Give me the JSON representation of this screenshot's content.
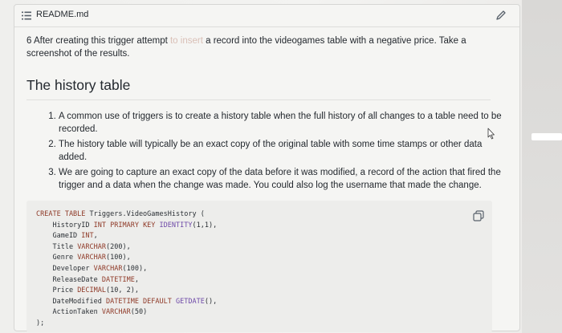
{
  "file": {
    "name": "README.md"
  },
  "intro": {
    "before": "6 After creating this trigger attempt ",
    "faded": "to insert",
    "after": " a record into the videogames table with a negative price. Take a screenshot of the results."
  },
  "section": {
    "title": "The history table"
  },
  "list": [
    "A common use of triggers is to create a history table when the full history of all changes to a table need to be recorded.",
    "The history table will typically be an exact copy of the original table with some time stamps or other data added.",
    "We are going to capture an exact copy of the data before it was modified, a record of the action that fired the trigger and a data when the change was made. You could also log the username that made the change."
  ],
  "code": {
    "lines": [
      [
        [
          "kw",
          "CREATE TABLE "
        ],
        [
          "txt",
          "Triggers.VideoGamesHistory ("
        ]
      ],
      [
        [
          "txt",
          "    HistoryID "
        ],
        [
          "kw",
          "INT PRIMARY KEY "
        ],
        [
          "fn",
          "IDENTITY"
        ],
        [
          "txt",
          "(1,1),"
        ]
      ],
      [
        [
          "txt",
          "    GameID "
        ],
        [
          "kw",
          "INT"
        ],
        [
          "txt",
          ","
        ]
      ],
      [
        [
          "txt",
          "    Title "
        ],
        [
          "kw",
          "VARCHAR"
        ],
        [
          "txt",
          "(200),"
        ]
      ],
      [
        [
          "txt",
          "    Genre "
        ],
        [
          "kw",
          "VARCHAR"
        ],
        [
          "txt",
          "(100),"
        ]
      ],
      [
        [
          "txt",
          "    Developer "
        ],
        [
          "kw",
          "VARCHAR"
        ],
        [
          "txt",
          "(100),"
        ]
      ],
      [
        [
          "txt",
          "    ReleaseDate "
        ],
        [
          "kw",
          "DATETIME"
        ],
        [
          "txt",
          ","
        ]
      ],
      [
        [
          "txt",
          "    Price "
        ],
        [
          "kw",
          "DECIMAL"
        ],
        [
          "txt",
          "(10, 2),"
        ]
      ],
      [
        [
          "txt",
          "    DateModified "
        ],
        [
          "kw",
          "DATETIME DEFAULT "
        ],
        [
          "fn",
          "GETDATE"
        ],
        [
          "txt",
          "(),"
        ]
      ],
      [
        [
          "txt",
          "    ActionTaken "
        ],
        [
          "kw",
          "VARCHAR"
        ],
        [
          "txt",
          "(50)"
        ]
      ],
      [
        [
          "txt",
          ");"
        ]
      ]
    ]
  },
  "icons": {
    "list": "list-icon",
    "edit": "pencil-icon",
    "copy": "copy-icon",
    "cursor": "cursor-icon"
  }
}
